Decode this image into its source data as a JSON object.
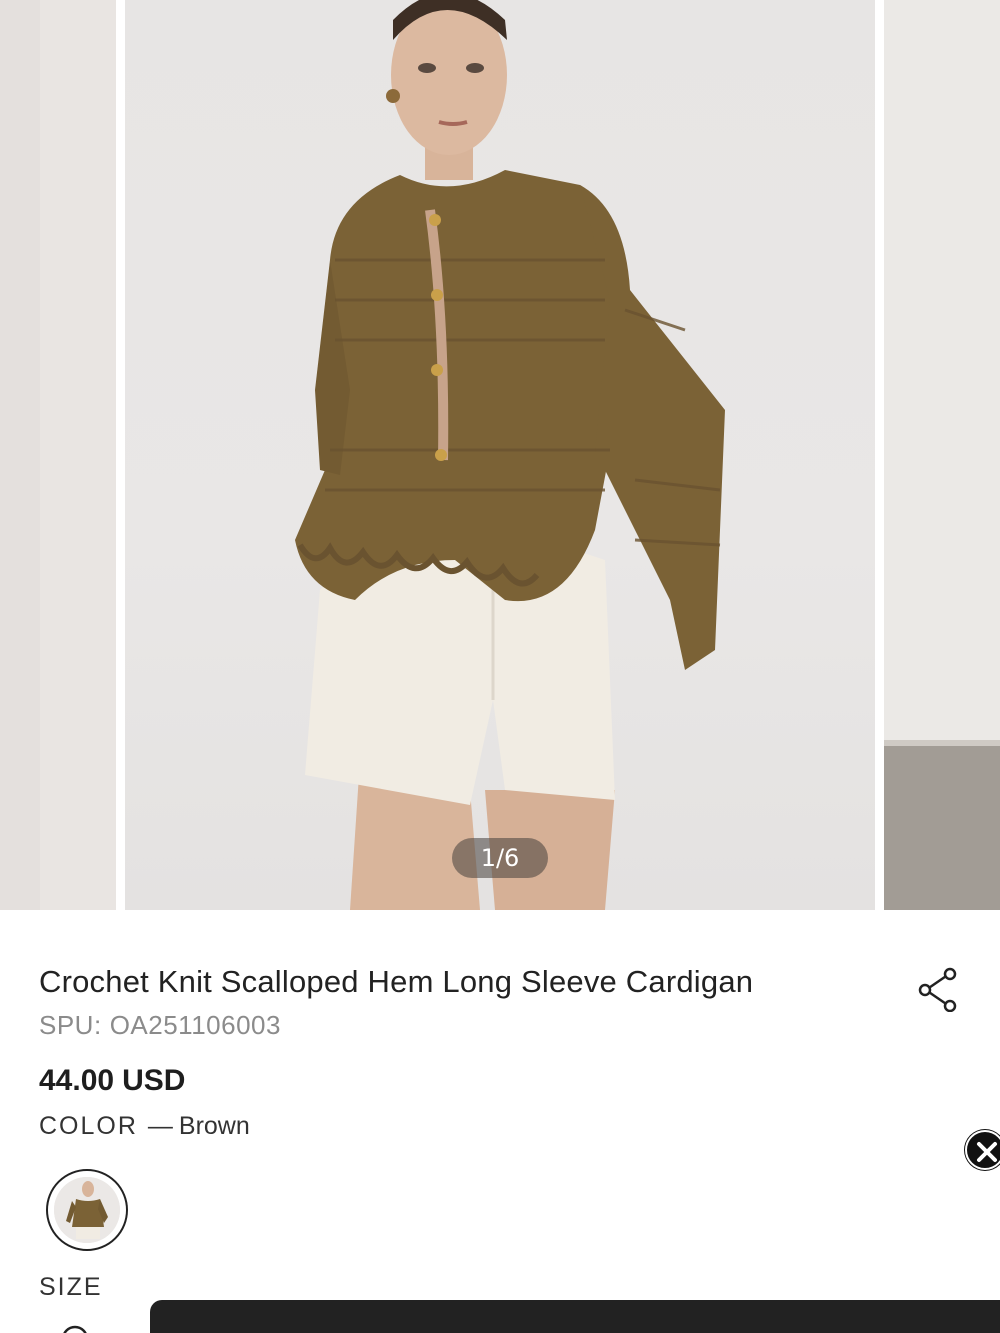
{
  "gallery": {
    "counter": "1/6",
    "image_desc_main": "model-brown-crochet-cardigan-white-shorts"
  },
  "product": {
    "title": "Crochet Knit Scalloped Hem Long Sleeve Cardigan",
    "spu_label": "SPU:",
    "spu_value": "OA251106003",
    "price_amount": "44.00",
    "price_currency": "USD",
    "color_label": "COLOR",
    "color_dash": "—",
    "color_value": "Brown",
    "size_label": "SIZE"
  },
  "icons": {
    "share": "share-icon",
    "close": "close-icon",
    "size_guide": "ruler-icon"
  },
  "colors": {
    "cardigan": "#7b6236",
    "shorts": "#f1ece3",
    "bottom_bar": "#222222"
  }
}
